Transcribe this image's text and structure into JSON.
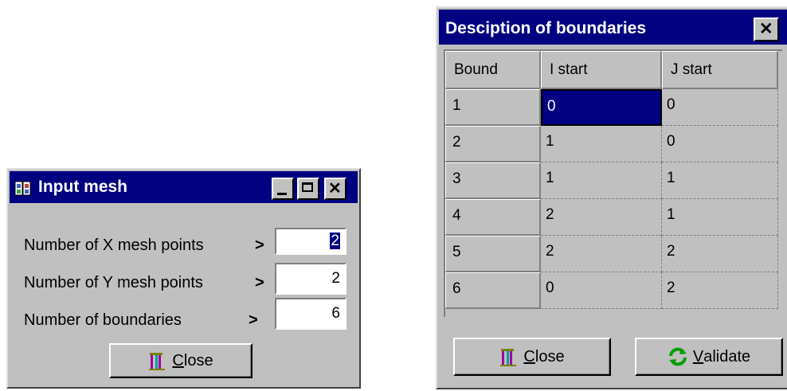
{
  "input_mesh": {
    "title": "Input mesh",
    "app_icon": "b-icon",
    "fields": [
      {
        "label": "Number of X mesh points",
        "arrow": ">",
        "value": "2"
      },
      {
        "label": "Number of Y mesh points",
        "arrow": ">",
        "value": "2"
      },
      {
        "label": "Number of boundaries",
        "arrow": ">",
        "value": "6"
      }
    ],
    "close_first": "C",
    "close_rest": "lose"
  },
  "boundaries": {
    "title": "Desciption of boundaries",
    "columns": [
      "Bound",
      "I start",
      "J start"
    ],
    "rows": [
      {
        "bound": "1",
        "i_start": "0",
        "j_start": "0"
      },
      {
        "bound": "2",
        "i_start": "1",
        "j_start": "0"
      },
      {
        "bound": "3",
        "i_start": "1",
        "j_start": "1"
      },
      {
        "bound": "4",
        "i_start": "2",
        "j_start": "1"
      },
      {
        "bound": "5",
        "i_start": "2",
        "j_start": "2"
      },
      {
        "bound": "6",
        "i_start": "0",
        "j_start": "2"
      }
    ],
    "close_first": "C",
    "close_rest": "lose",
    "validate_first": "V",
    "validate_rest": "alidate"
  },
  "colors": {
    "title_bar": "#000080",
    "face": "#c0c0c0",
    "selection": "#000080"
  }
}
